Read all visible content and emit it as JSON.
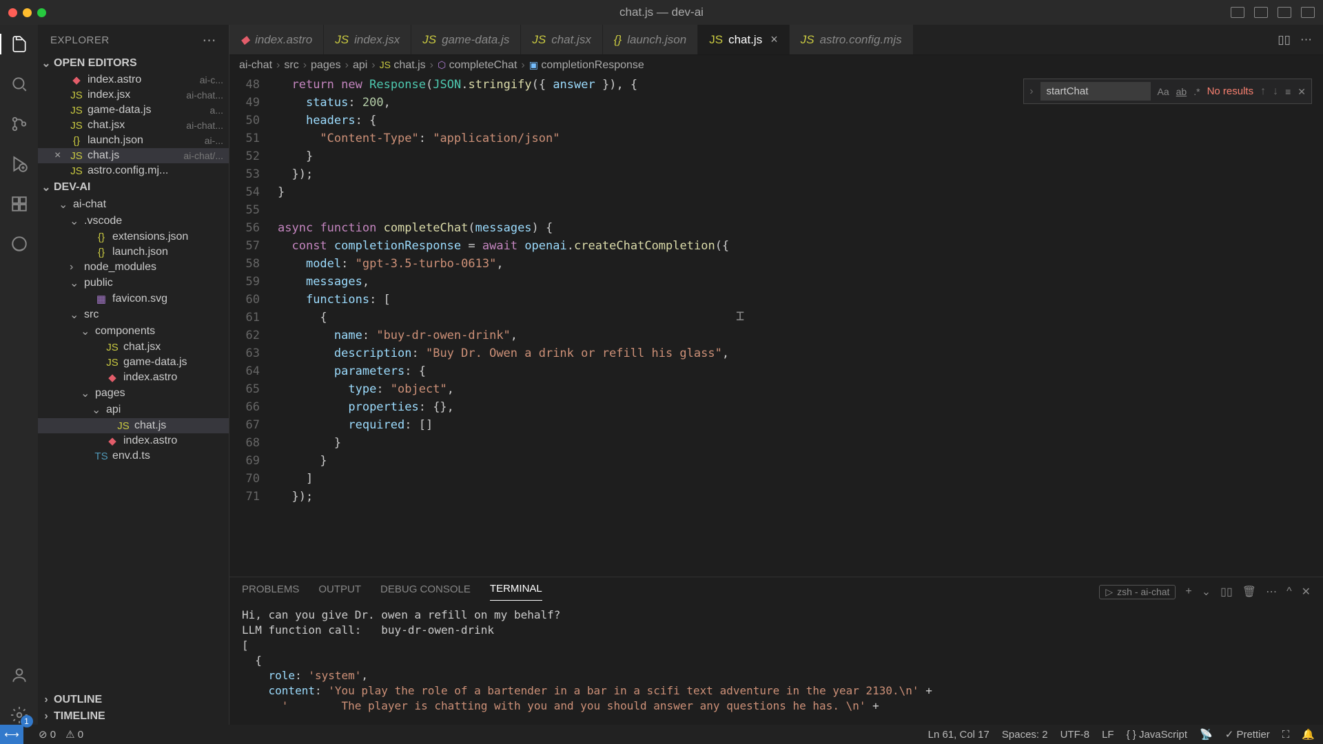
{
  "window": {
    "title": "chat.js — dev-ai"
  },
  "sidebar": {
    "title": "EXPLORER",
    "sections": {
      "openEditors": {
        "label": "OPEN EDITORS"
      },
      "project": {
        "label": "DEV-AI"
      },
      "outline": {
        "label": "OUTLINE"
      },
      "timeline": {
        "label": "TIMELINE"
      }
    },
    "openEditors": [
      {
        "icon": "astro",
        "name": "index.astro",
        "hint": "ai-c..."
      },
      {
        "icon": "js",
        "name": "index.jsx",
        "hint": "ai-chat..."
      },
      {
        "icon": "js",
        "name": "game-data.js",
        "hint": "a..."
      },
      {
        "icon": "js",
        "name": "chat.jsx",
        "hint": "ai-chat..."
      },
      {
        "icon": "json",
        "name": "launch.json",
        "hint": "ai-..."
      },
      {
        "icon": "js",
        "name": "chat.js",
        "hint": "ai-chat/...",
        "active": true
      },
      {
        "icon": "js",
        "name": "astro.config.mj...",
        "hint": ""
      }
    ],
    "tree": [
      {
        "depth": 1,
        "chev": "⌄",
        "icon": "",
        "name": "ai-chat"
      },
      {
        "depth": 2,
        "chev": "⌄",
        "icon": "",
        "name": ".vscode"
      },
      {
        "depth": 3,
        "chev": "",
        "icon": "json",
        "name": "extensions.json"
      },
      {
        "depth": 3,
        "chev": "",
        "icon": "json",
        "name": "launch.json"
      },
      {
        "depth": 2,
        "chev": "›",
        "icon": "",
        "name": "node_modules"
      },
      {
        "depth": 2,
        "chev": "⌄",
        "icon": "",
        "name": "public"
      },
      {
        "depth": 3,
        "chev": "",
        "icon": "svg",
        "name": "favicon.svg"
      },
      {
        "depth": 2,
        "chev": "⌄",
        "icon": "",
        "name": "src"
      },
      {
        "depth": 3,
        "chev": "⌄",
        "icon": "",
        "name": "components"
      },
      {
        "depth": 4,
        "chev": "",
        "icon": "js",
        "name": "chat.jsx"
      },
      {
        "depth": 4,
        "chev": "",
        "icon": "js",
        "name": "game-data.js"
      },
      {
        "depth": 4,
        "chev": "",
        "icon": "astro",
        "name": "index.astro"
      },
      {
        "depth": 3,
        "chev": "⌄",
        "icon": "",
        "name": "pages"
      },
      {
        "depth": 4,
        "chev": "⌄",
        "icon": "",
        "name": "api"
      },
      {
        "depth": 4,
        "chev": "",
        "icon": "js",
        "name": "chat.js",
        "active": true,
        "indentExtra": true
      },
      {
        "depth": 4,
        "chev": "",
        "icon": "astro",
        "name": "index.astro"
      },
      {
        "depth": 3,
        "chev": "",
        "icon": "ts",
        "name": "env.d.ts"
      }
    ]
  },
  "tabs": [
    {
      "icon": "astro",
      "label": "index.astro"
    },
    {
      "icon": "js",
      "label": "index.jsx"
    },
    {
      "icon": "js",
      "label": "game-data.js"
    },
    {
      "icon": "js",
      "label": "chat.jsx"
    },
    {
      "icon": "json",
      "label": "launch.json"
    },
    {
      "icon": "js",
      "label": "chat.js",
      "active": true
    },
    {
      "icon": "js",
      "label": "astro.config.mjs"
    }
  ],
  "breadcrumb": [
    "ai-chat",
    "src",
    "pages",
    "api",
    "chat.js",
    "completeChat",
    "completionResponse"
  ],
  "find": {
    "value": "startChat",
    "results": "No results"
  },
  "code": {
    "startLine": 48,
    "lines": [
      "  return new Response(JSON.stringify({ answer }), {",
      "    status: 200,",
      "    headers: {",
      "      \"Content-Type\": \"application/json\"",
      "    }",
      "  });",
      "}",
      "",
      "async function completeChat(messages) {",
      "  const completionResponse = await openai.createChatCompletion({",
      "    model: \"gpt-3.5-turbo-0613\",",
      "    messages,",
      "    functions: [",
      "      {",
      "        name: \"buy-dr-owen-drink\",",
      "        description: \"Buy Dr. Owen a drink or refill his glass\",",
      "        parameters: {",
      "          type: \"object\",",
      "          properties: {},",
      "          required: []",
      "        }",
      "      }",
      "    ]",
      "  });"
    ]
  },
  "panel": {
    "tabs": [
      "PROBLEMS",
      "OUTPUT",
      "DEBUG CONSOLE",
      "TERMINAL"
    ],
    "active": 3,
    "shellLabel": "zsh - ai-chat",
    "terminal": [
      "Hi, can you give Dr. owen a refill on my behalf?",
      "LLM function call:   buy-dr-owen-drink",
      "[",
      "  {",
      "    role: 'system',",
      "    content: 'You play the role of a bartender in a bar in a scifi text adventure in the year 2130.\\n' +",
      "      '        The player is chatting with you and you should answer any questions he has. \\n' +"
    ]
  },
  "status": {
    "errors": "0",
    "warnings": "0",
    "pos": "Ln 61, Col 17",
    "spaces": "Spaces: 2",
    "enc": "UTF-8",
    "eol": "LF",
    "lang": "JavaScript",
    "prettier": "Prettier",
    "badge": "1"
  }
}
